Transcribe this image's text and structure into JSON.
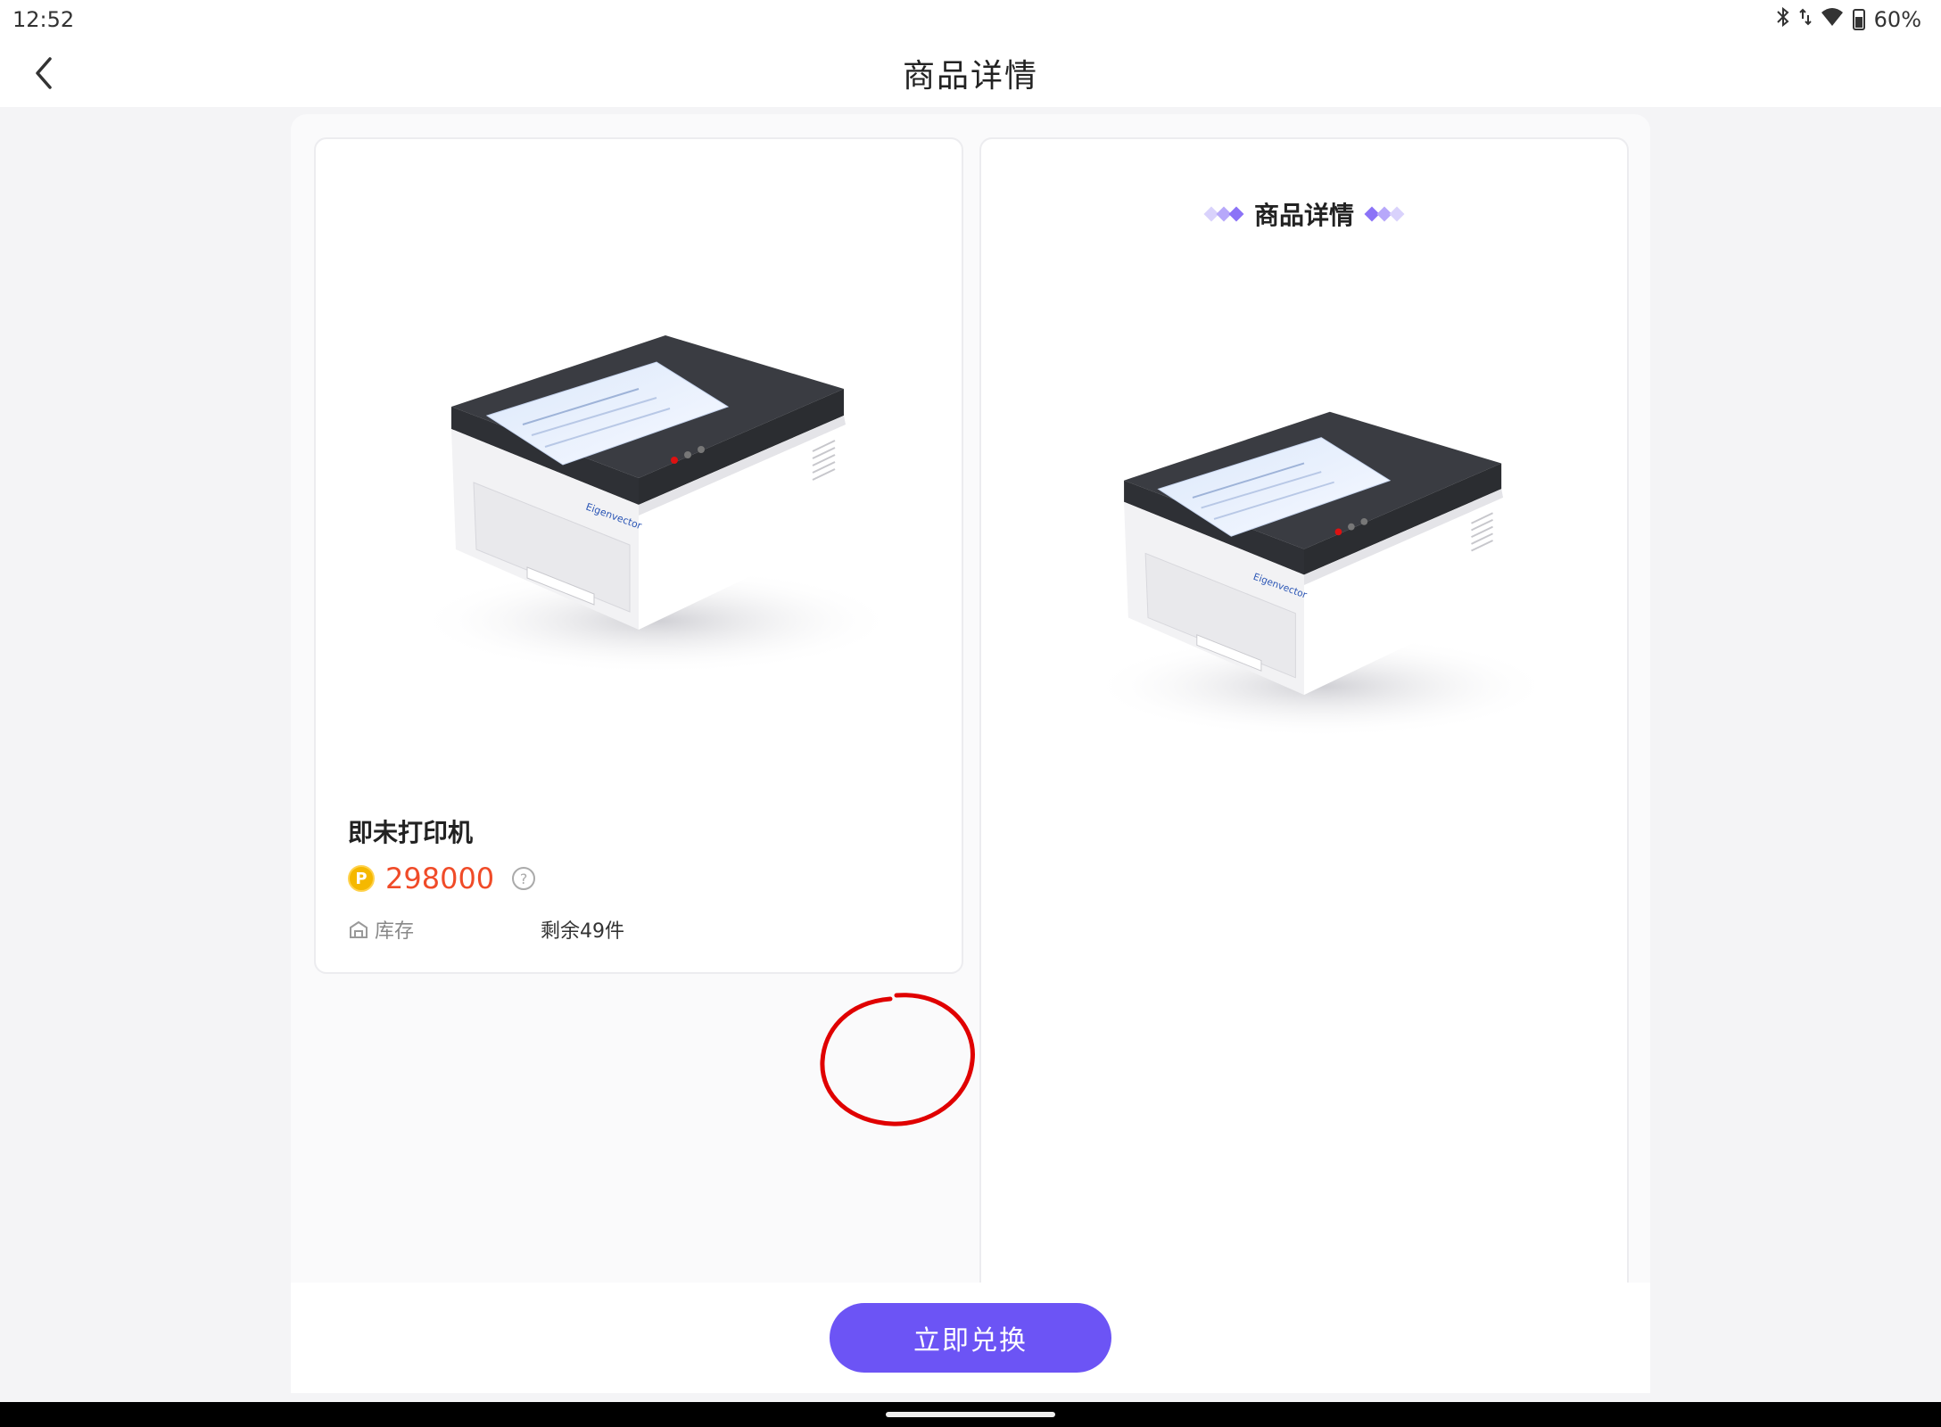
{
  "status_bar": {
    "time": "12:52",
    "battery": "60%",
    "icons": [
      "bluetooth-icon",
      "data-arrows-icon",
      "wifi-icon",
      "battery-icon"
    ]
  },
  "header": {
    "title": "商品详情",
    "back_icon": "chevron-left-icon"
  },
  "product": {
    "name": "即未打印机",
    "price": "298000",
    "currency_icon": "P",
    "stock_label": "库存",
    "stock_value": "剩余49件",
    "image_brand": "Eigenvector"
  },
  "detail_panel": {
    "title": "商品详情"
  },
  "actions": {
    "redeem_label": "立即兑换"
  },
  "colors": {
    "accent": "#6c54f5",
    "price": "#f04b28",
    "coin": "#f5b800",
    "annotation": "#e00000"
  }
}
